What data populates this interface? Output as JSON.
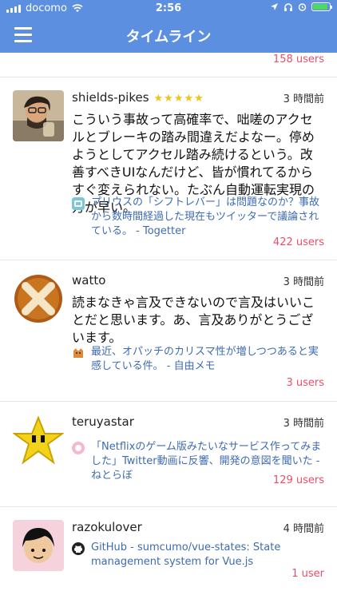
{
  "status_bar": {
    "carrier": "docomo",
    "time": "2:56"
  },
  "navbar": {
    "title": "タイムライン"
  },
  "top_partial": {
    "users": "158 users"
  },
  "items": [
    {
      "name": "shields-pikes",
      "stars": "★★★★★",
      "time": "3 時間前",
      "text": "こういう事故って高確率で、咄嗟のアクセルとブレーキの踏み間違えだよなー。停めようとしてアクセル踏み続けるという。改善すべきUIなんだけど、皆が慣れてるからすぐ変えられない。たぶん自動運転実現の方が早い。",
      "link": "プリウスの「シフトレバー」は問題なのか？事故から数時間経過した現在もツイッターで議論されている。 - Togetter",
      "users": "422 users"
    },
    {
      "name": "watto",
      "time": "3 時間前",
      "text": "読まなきゃ言及できないので言及はいいことだと思います。あ、言及ありがとうございます。",
      "link": "最近、オパッチのカリスマ性が増しつつあると実感している件。 - 自由メモ",
      "users": "3 users"
    },
    {
      "name": "teruyastar",
      "time": "3 時間前",
      "text": "",
      "link": "「Netflixのゲーム版みたいなサービス作ってみました」Twitter動画に反響、開発の意図を聞いた - ねとらぼ",
      "users": "129 users"
    },
    {
      "name": "razokulover",
      "time": "4 時間前",
      "text": "",
      "link": "GitHub - sumcumo/vue-states: State management system for Vue.js",
      "users": "1 user"
    }
  ]
}
